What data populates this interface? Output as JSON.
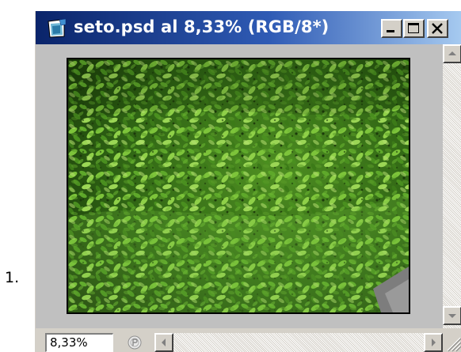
{
  "list_marker": "1.",
  "window": {
    "title": "seto.psd al 8,33% (RGB/8*)",
    "icon": "photoshop-document-icon",
    "buttons": [
      "minimize-icon",
      "maximize-icon",
      "close-icon"
    ]
  },
  "statusbar": {
    "zoom_value": "8,33%",
    "status_icon": "status-info-icon"
  },
  "document": {
    "image": "green-hedge-photo"
  },
  "colors": {
    "title_bar_start": "#0a246a",
    "title_bar_end": "#a6caf0",
    "chrome": "#d4d0c8",
    "canvas_background": "#c0c0c0"
  }
}
